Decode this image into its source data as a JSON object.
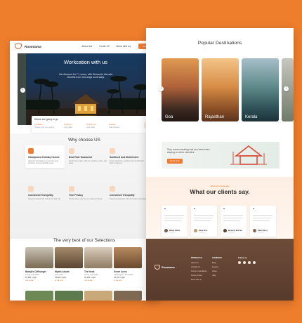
{
  "left": {
    "nav": {
      "logo": "Roomtama",
      "links": [
        "About Us",
        "Covid-19",
        "Book with us"
      ],
      "login": "Login"
    },
    "hero": {
      "title": "Workcation with us",
      "subtitle": "Get discount for 7+ rooms, with Discounts that add benefits from mid-range work stays"
    },
    "search": {
      "label": "Where are going to go",
      "fields": [
        {
          "label": "Location",
          "value": "Where are you going"
        },
        {
          "label": "Check in",
          "value": "Add date"
        },
        {
          "label": "Check out",
          "value": "Add date"
        },
        {
          "label": "Guests",
          "value": "Add guests"
        }
      ]
    },
    "why": {
      "title": "Why choose US",
      "features": [
        {
          "title": "Handpicked Holiday Homes",
          "desc": "Handpicked holiday homes with great locations and comfortable stays"
        },
        {
          "title": "Best Rate Guarantee",
          "desc": "Get the best rates with our exclusive offers and deals"
        },
        {
          "title": "Sanitised and Disinfected",
          "desc": "Every property is sanitised and disinfected before check-in"
        },
        {
          "title": "Connected Tranquility",
          "desc": "Stay connected with nature and fast wifi"
        },
        {
          "title": "True Privacy",
          "desc": "Private stays only for you and your family"
        },
        {
          "title": "Connected Tranquility",
          "desc": "Peaceful properties with all modern amenities"
        }
      ]
    },
    "best": {
      "title": "The very best of our Selections",
      "listings": [
        {
          "name": "Babaji's Cliffhanger",
          "loc": "Coorg, Karnataka",
          "price": "₹4,500 / night",
          "stars": "★★★★★"
        },
        {
          "name": "Mystic Abode",
          "loc": "Goa, India",
          "price": "₹3,800 / night",
          "stars": "★★★★★"
        },
        {
          "name": "The Nook",
          "loc": "Coorg, Karnataka",
          "price": "₹5,200 / night",
          "stars": "★★★★★"
        },
        {
          "name": "Green Acres",
          "loc": "Chikmagalur, Karnataka",
          "price": "₹4,100 / night",
          "stars": "★★★★★"
        }
      ]
    }
  },
  "right": {
    "popular": {
      "title": "Popular Destinations",
      "destinations": [
        "Goa",
        "Rajasthan",
        "Kerala"
      ]
    },
    "promo": {
      "text": "Stop communicating that you have been staying on other websites.",
      "button": "Book now"
    },
    "clients": {
      "kicker": "What our clients say",
      "title": "What our clients say.",
      "testimonials": [
        {
          "name": "Maria Wells",
          "role": "Traveller"
        },
        {
          "name": "Jane Doe",
          "role": "Traveller"
        },
        {
          "name": "Beverly Burner",
          "role": "Traveller"
        },
        {
          "name": "Sam Berry",
          "role": "Traveller"
        }
      ]
    },
    "footer": {
      "logo": "Roomtama",
      "columns": [
        {
          "title": "PRODUCTS",
          "items": [
            "About Us",
            "Contact Us",
            "Terms & Conditions",
            "Privacy Policy",
            "Book with us"
          ]
        },
        {
          "title": "COMPANY",
          "items": [
            "Blog",
            "Careers",
            "Press",
            "Help"
          ]
        },
        {
          "title": "Follow us",
          "items": []
        }
      ]
    }
  },
  "colors": {
    "background": "#ee7d2c",
    "accent": "#f07a2e",
    "footer": "#614232"
  }
}
